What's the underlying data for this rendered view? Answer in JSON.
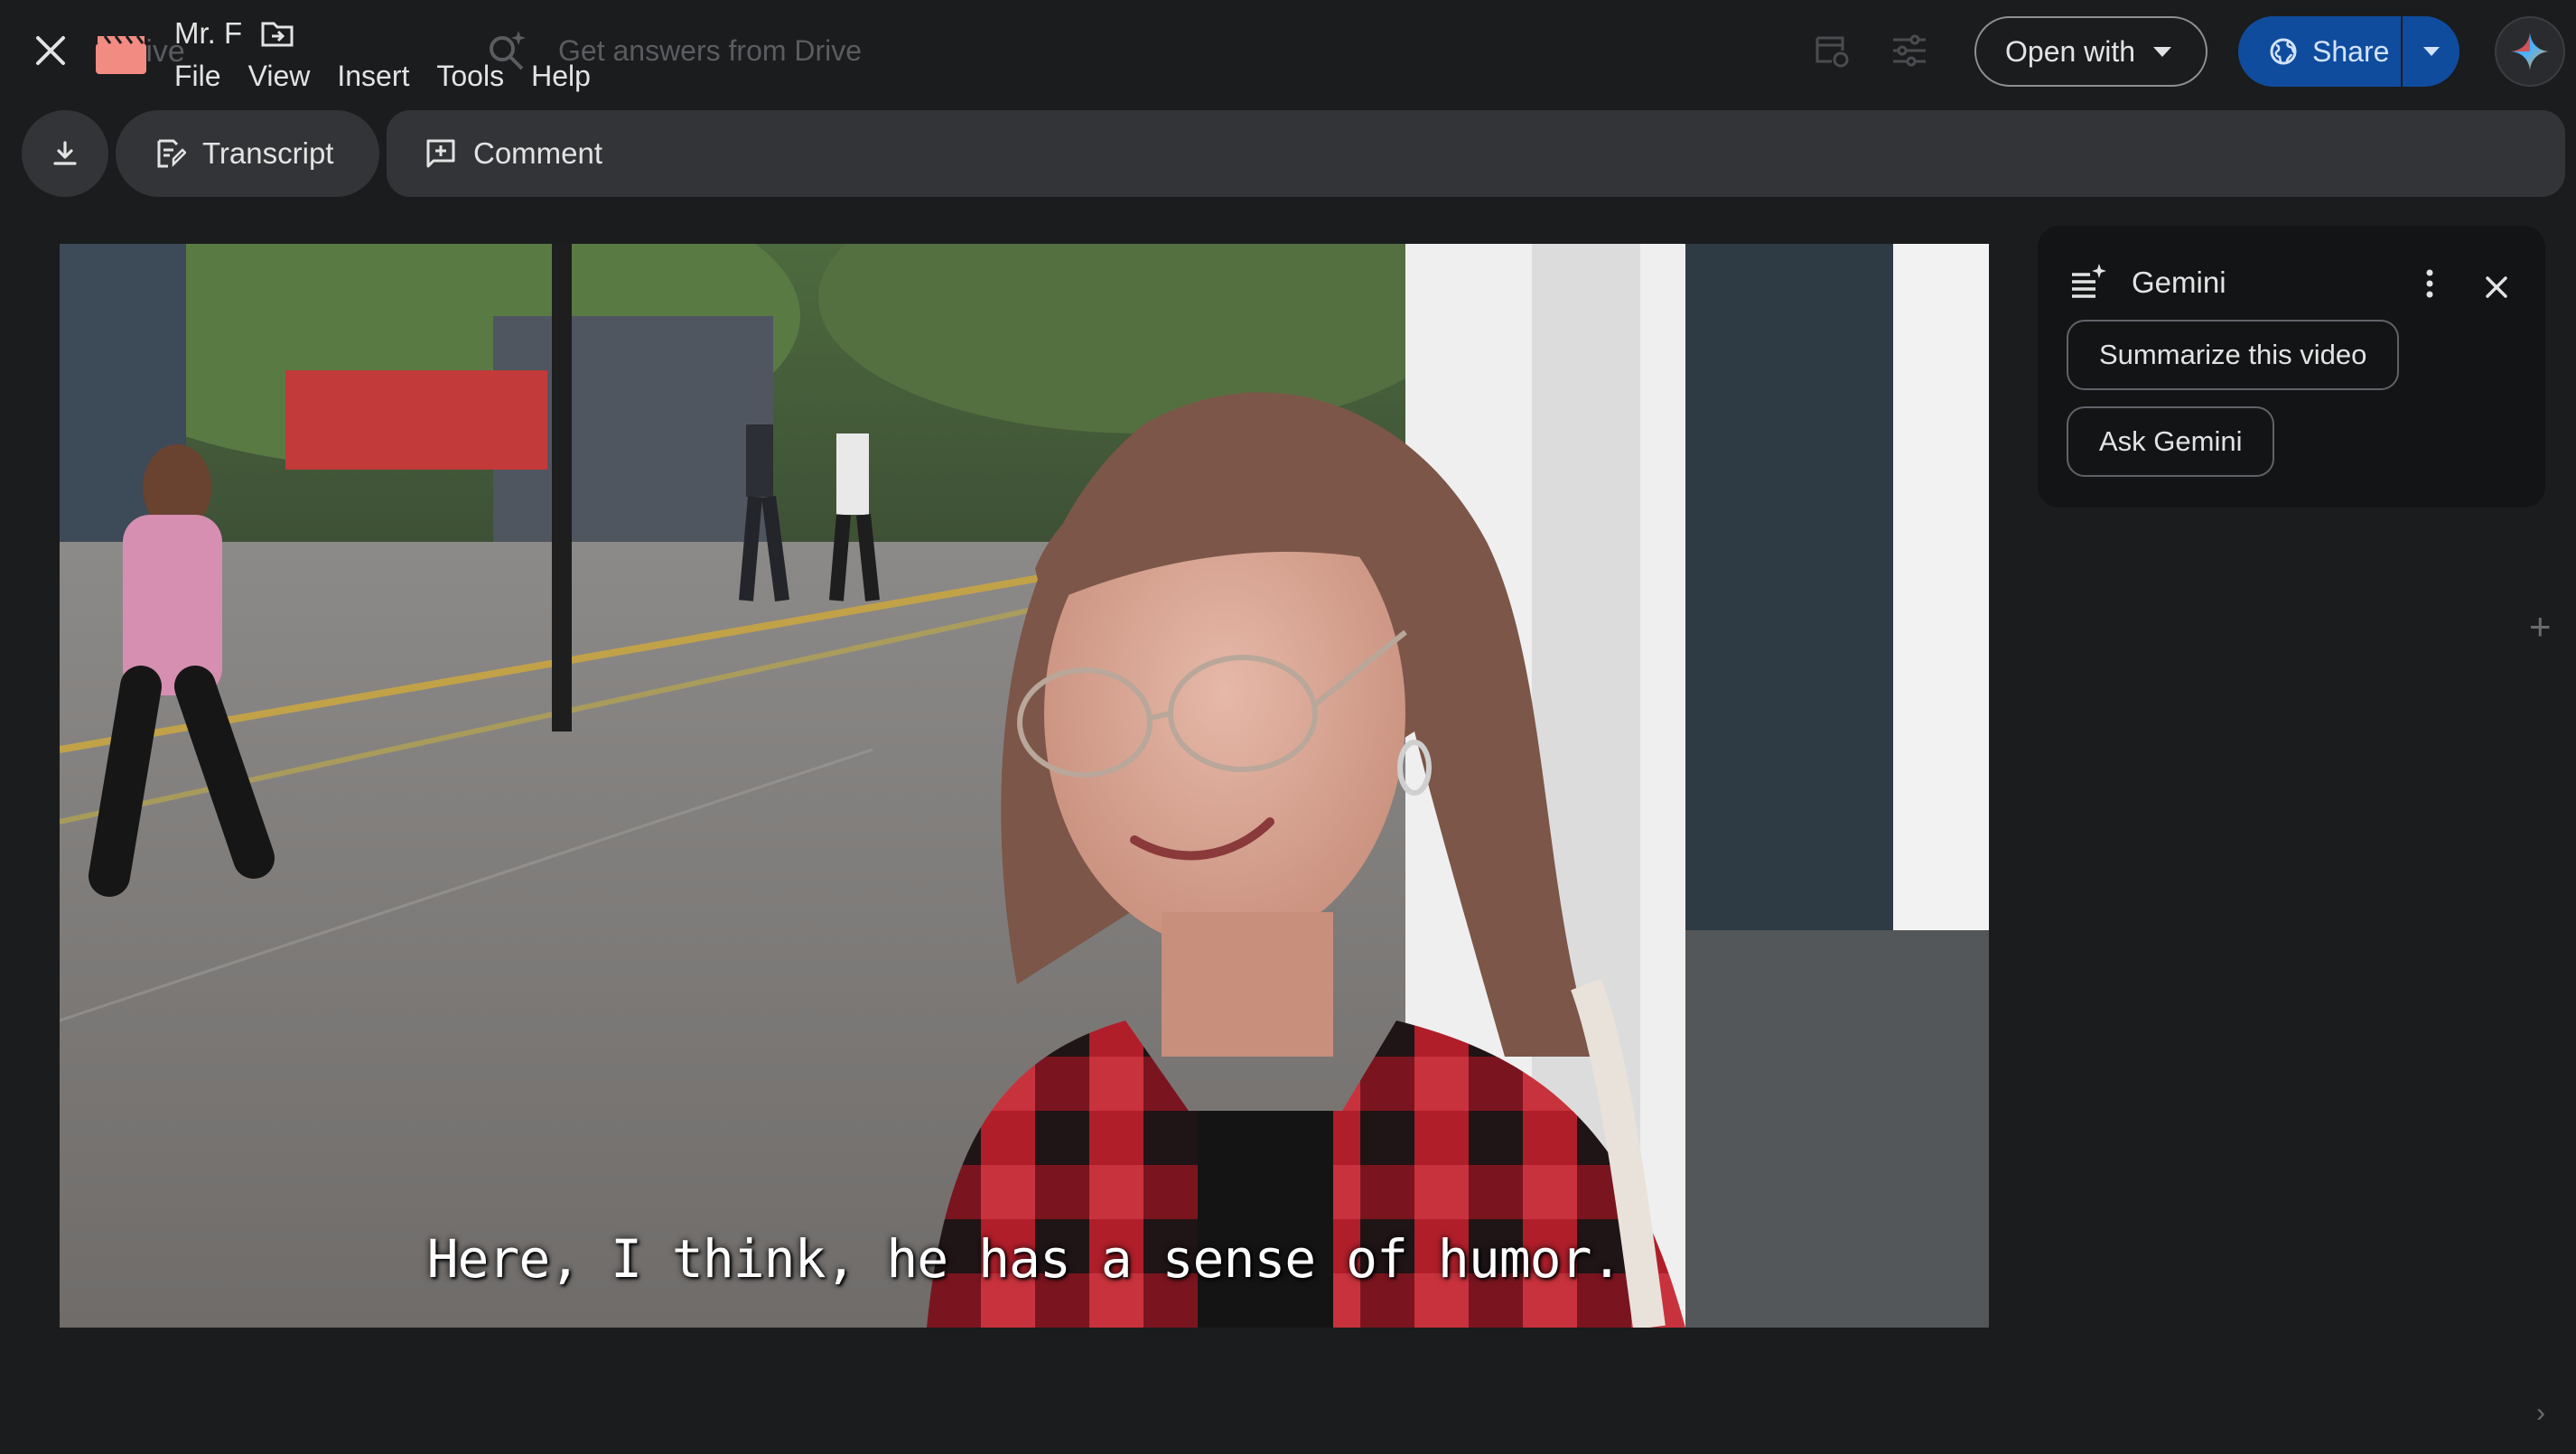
{
  "header": {
    "ghost_app_name": "rive",
    "ghost_search_placeholder": "Get answers from Drive",
    "title": "Mr. F",
    "menu": [
      "File",
      "View",
      "Insert",
      "Tools",
      "Help"
    ],
    "open_with_label": "Open with",
    "share_label": "Share"
  },
  "toolbar": {
    "transcript_label": "Transcript",
    "comment_label": "Comment"
  },
  "video": {
    "caption": "Here, I think, he has a sense of humor."
  },
  "gemini": {
    "title": "Gemini",
    "suggestions": [
      "Summarize this video",
      "Ask Gemini"
    ]
  },
  "colors": {
    "background": "#1b1c1e",
    "share_button": "#0f4c9e",
    "toolbar": "#323437",
    "panel": "#131416"
  }
}
